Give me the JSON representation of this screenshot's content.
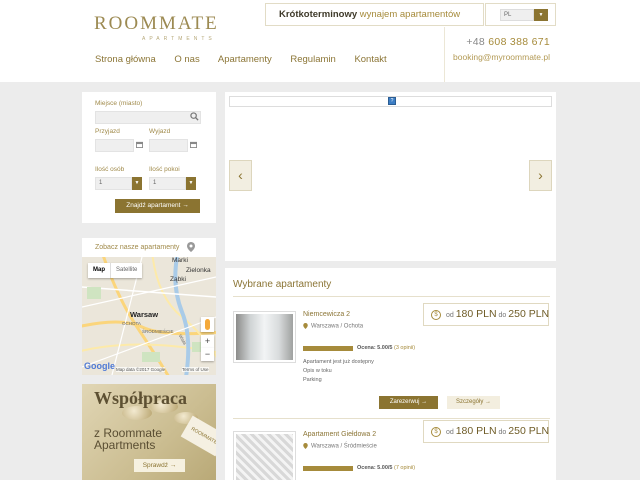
{
  "header": {
    "logo_text": "ROOMMATE",
    "logo_sub": "APARTMENTS",
    "tagline_bold": "Krótkoterminowy",
    "tagline_rest": "wynajem apartamentów",
    "language": "PL",
    "phone_prefix": "+48",
    "phone_number": "608 388 671",
    "email": "booking@myroommate.pl",
    "nav": [
      "Strona główna",
      "O nas",
      "Apartamenty",
      "Regulamin",
      "Kontakt"
    ]
  },
  "search": {
    "place_label": "Miejsce (miasto)",
    "place_value": "",
    "arrival_label": "Przyjazd",
    "departure_label": "Wyjazd",
    "persons_label": "Ilość osób",
    "persons_value": "1",
    "rooms_label": "Ilość pokoi",
    "rooms_value": "1",
    "find_button": "Znajdź apartament"
  },
  "map": {
    "title": "Zobacz nasze apartamenty",
    "tab_map": "Map",
    "tab_satellite": "Satellite",
    "labels": [
      "Marki",
      "Zielonka",
      "Ząbki",
      "Warsaw",
      "OCHOTA",
      "ŚRÓDMIEŚCIE",
      "Wisła"
    ],
    "zoom_in": "+",
    "zoom_out": "−",
    "google": "Google",
    "map_data": "Map data ©2017 Google",
    "terms": "Terms of Use"
  },
  "promo": {
    "title": "Współpraca",
    "subtitle1": "z Roommate",
    "subtitle2": "Apartments",
    "card_text": "ROOMMATE",
    "button": "Sprawdź"
  },
  "slider": {
    "prev": "‹",
    "next": "›"
  },
  "featured": {
    "title": "Wybrane apartamenty",
    "items": [
      {
        "name": "Niemcewicza 2",
        "location": "Warszawa / Ochota",
        "price_from_word": "od",
        "price_from": "180 PLN",
        "price_to_word": "do",
        "price_to": "250 PLN",
        "rating": "Ocena: 5.00/5",
        "opinions": "(3 opinii)",
        "features": [
          "Apartament jest już dostępny",
          "Opis w toku",
          "Parking"
        ],
        "reserve": "Zarezerwuj",
        "details": "Szczegóły"
      },
      {
        "name": "Apartament Giełdowa 2",
        "location": "Warszawa / Śródmieście",
        "price_from_word": "od",
        "price_from": "180 PLN",
        "price_to_word": "do",
        "price_to": "250 PLN",
        "rating": "Ocena: 5.00/5",
        "opinions": "(7 opinii)"
      }
    ]
  },
  "colors": {
    "gold": "#8b7431",
    "gold_light": "#a68b3b",
    "background": "#ececec"
  }
}
